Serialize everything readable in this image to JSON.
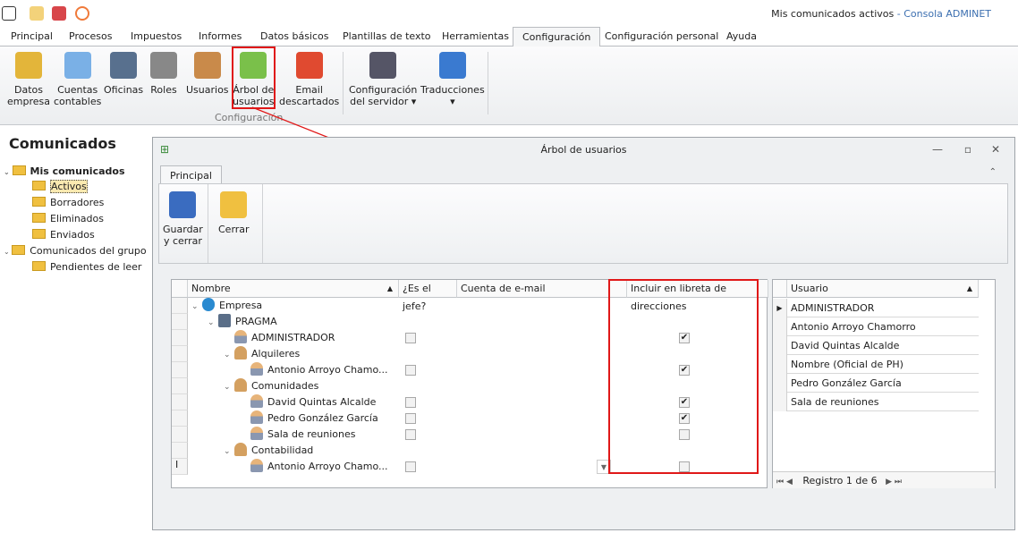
{
  "window_title": {
    "doc": "Mis comunicados activos",
    "sep": " - ",
    "app": "Consola ADMINET"
  },
  "tabs": [
    "Principal",
    "Procesos",
    "Impuestos",
    "Informes",
    "Datos básicos",
    "Plantillas de texto",
    "Herramientas",
    "Configuración",
    "Configuración personal",
    "Ayuda"
  ],
  "active_tab": "Configuración",
  "ribbon": {
    "buttons": [
      {
        "label": "Datos\nempresa",
        "icon": "database-icon"
      },
      {
        "label": "Cuentas\ncontables",
        "icon": "ledger-icon"
      },
      {
        "label": "Oficinas",
        "icon": "servers-icon"
      },
      {
        "label": "Roles",
        "icon": "lock-icon"
      },
      {
        "label": "Usuarios",
        "icon": "users-icon"
      },
      {
        "label": "Árbol de\nusuarios",
        "icon": "org-tree-icon"
      },
      {
        "label": "Email\ndescartados",
        "icon": "blocked-email-icon"
      },
      {
        "label": "Configuración\ndel servidor ▾",
        "icon": "tools-icon"
      },
      {
        "label": "Traducciones\n▾",
        "icon": "translate-icon"
      }
    ],
    "group": "Configuración"
  },
  "sidebar": {
    "title": "Comunicados",
    "items": [
      {
        "label": "Mis comunicados",
        "bold": true
      },
      {
        "label": "Activos"
      },
      {
        "label": "Borradores"
      },
      {
        "label": "Eliminados"
      },
      {
        "label": "Enviados"
      },
      {
        "label": "Comunicados del grupo"
      },
      {
        "label": "Pendientes de leer"
      }
    ]
  },
  "dialog": {
    "title": "Árbol de usuarios",
    "tab": "Principal",
    "buttons": [
      "Guardar\ny cerrar",
      "Cerrar"
    ],
    "columns": [
      "Nombre",
      "¿Es el jefe?",
      "Cuenta de e-mail",
      "Incluir en libreta de direcciones"
    ],
    "rows": [
      {
        "name": "Empresa",
        "level": 0,
        "type": "root"
      },
      {
        "name": "PRAGMA",
        "level": 1,
        "type": "company"
      },
      {
        "name": "ADMINISTRADOR",
        "level": 2,
        "type": "user",
        "boss": false,
        "include": true
      },
      {
        "name": "Alquileres",
        "level": 2,
        "type": "group"
      },
      {
        "name": "Antonio Arroyo Chamo...",
        "level": 3,
        "type": "user",
        "boss": false,
        "include": true
      },
      {
        "name": "Comunidades",
        "level": 2,
        "type": "group"
      },
      {
        "name": "David Quintas Alcalde",
        "level": 3,
        "type": "user",
        "boss": false,
        "include": true
      },
      {
        "name": "Pedro González García",
        "level": 3,
        "type": "user",
        "boss": false,
        "include": true
      },
      {
        "name": "Sala de reuniones",
        "level": 3,
        "type": "user",
        "boss": false,
        "include": false
      },
      {
        "name": "Contabilidad",
        "level": 2,
        "type": "group"
      },
      {
        "name": "Antonio Arroyo Chamo...",
        "level": 3,
        "type": "user",
        "boss": false,
        "include": false
      }
    ],
    "user_column": "Usuario",
    "users": [
      "ADMINISTRADOR",
      "Antonio Arroyo Chamorro",
      "David Quintas Alcalde",
      "Nombre (Oficial de PH)",
      "Pedro González García",
      "Sala de reuniones"
    ],
    "pager": "Registro 1 de 6"
  },
  "highlight_color": "#e01818"
}
